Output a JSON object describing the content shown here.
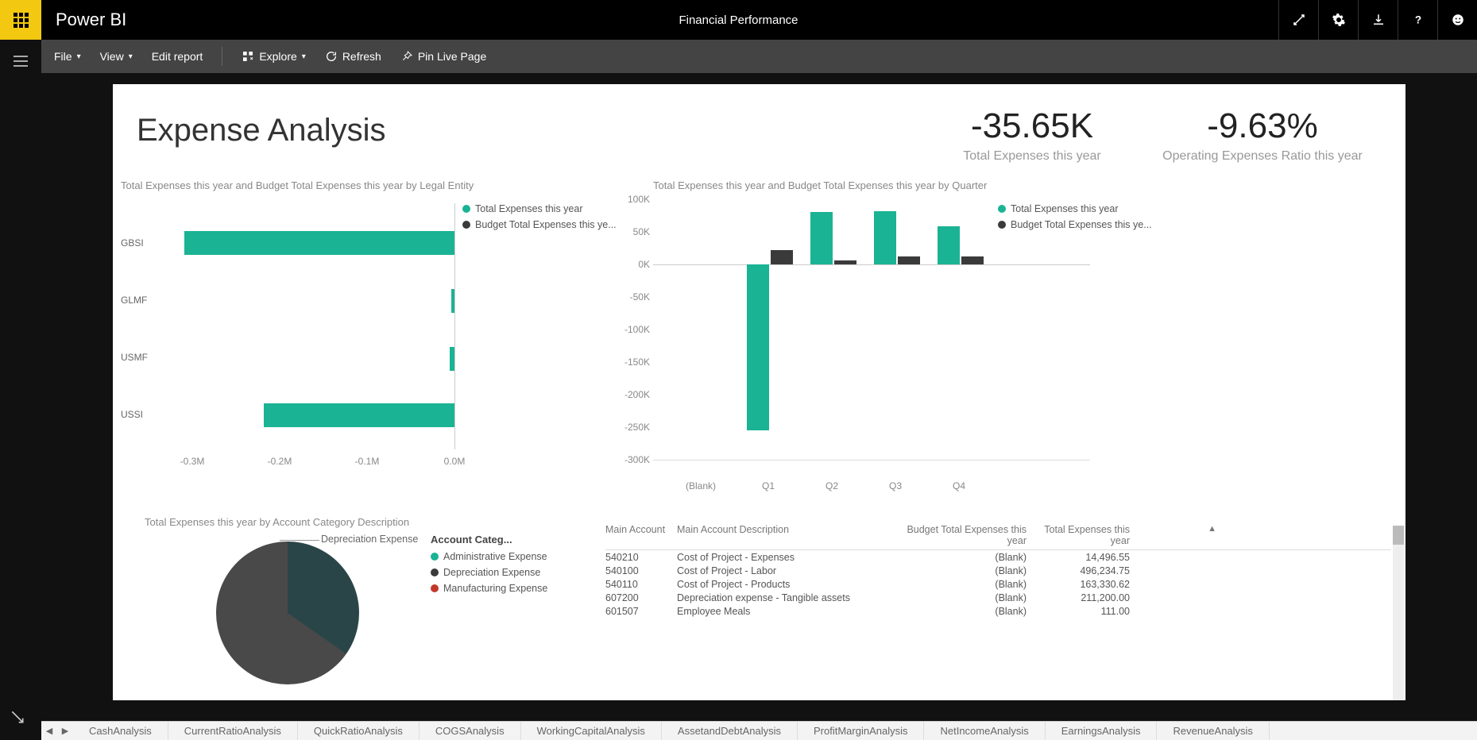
{
  "app": {
    "name": "Power BI",
    "title": "Financial Performance"
  },
  "toolbar": {
    "file": "File",
    "view": "View",
    "edit": "Edit report",
    "explore": "Explore",
    "refresh": "Refresh",
    "pin": "Pin Live Page"
  },
  "report": {
    "title": "Expense Analysis",
    "kpi1": {
      "value": "-35.65K",
      "label": "Total Expenses this year"
    },
    "kpi2": {
      "value": "-9.63%",
      "label": "Operating Expenses Ratio this year"
    },
    "chart1": {
      "title": "Total Expenses this year and Budget Total Expenses this year by Legal Entity",
      "legend1": "Total Expenses this year",
      "legend2": "Budget Total Expenses this ye...",
      "yticks": [
        "GBSI",
        "GLMF",
        "USMF",
        "USSI"
      ],
      "xticks": [
        "-0.3M",
        "-0.2M",
        "-0.1M",
        "0.0M"
      ]
    },
    "chart2": {
      "title": "Total Expenses this year and Budget Total Expenses this year by Quarter",
      "legend1": "Total Expenses this year",
      "legend2": "Budget Total Expenses this ye...",
      "yticks": [
        "100K",
        "50K",
        "0K",
        "-50K",
        "-100K",
        "-150K",
        "-200K",
        "-250K",
        "-300K"
      ],
      "xticks": [
        "(Blank)",
        "Q1",
        "Q2",
        "Q3",
        "Q4"
      ]
    },
    "chart3": {
      "title": "Total Expenses this year by Account Category Description",
      "pie_label": "Depreciation Expense"
    },
    "acct": {
      "title": "Account Categ...",
      "items": [
        "Administrative Expense",
        "Depreciation Expense",
        "Manufacturing Expense"
      ],
      "colors": [
        "#1ab394",
        "#3a3a3a",
        "#c0392b"
      ]
    },
    "table": {
      "headers": [
        "Main Account",
        "Main Account Description",
        "Budget Total Expenses this year",
        "Total Expenses this year"
      ],
      "rows": [
        [
          "540210",
          "Cost of Project  - Expenses",
          "(Blank)",
          "14,496.55"
        ],
        [
          "540100",
          "Cost of Project  - Labor",
          "(Blank)",
          "496,234.75"
        ],
        [
          "540110",
          "Cost of Project  - Products",
          "(Blank)",
          "163,330.62"
        ],
        [
          "607200",
          "Depreciation expense - Tangible assets",
          "(Blank)",
          "211,200.00"
        ],
        [
          "601507",
          "Employee Meals",
          "(Blank)",
          "111.00"
        ]
      ]
    }
  },
  "tabs": [
    "CashAnalysis",
    "CurrentRatioAnalysis",
    "QuickRatioAnalysis",
    "COGSAnalysis",
    "WorkingCapitalAnalysis",
    "AssetandDebtAnalysis",
    "ProfitMarginAnalysis",
    "NetIncomeAnalysis",
    "EarningsAnalysis",
    "RevenueAnalysis"
  ],
  "chart_data": [
    {
      "type": "bar",
      "orientation": "horizontal",
      "title": "Total Expenses this year and Budget Total Expenses this year by Legal Entity",
      "categories": [
        "GBSI",
        "GLMF",
        "USMF",
        "USSI"
      ],
      "xlabel": "",
      "ylabel": "",
      "xlim": [
        -300000,
        0
      ],
      "series": [
        {
          "name": "Total Expenses this year",
          "values": [
            -310000,
            -2000,
            -3000,
            -220000
          ]
        },
        {
          "name": "Budget Total Expenses this year",
          "values": [
            0,
            0,
            0,
            0
          ]
        }
      ]
    },
    {
      "type": "bar",
      "title": "Total Expenses this year and Budget Total Expenses this year by Quarter",
      "categories": [
        "(Blank)",
        "Q1",
        "Q2",
        "Q3",
        "Q4"
      ],
      "ylim": [
        -300000,
        100000
      ],
      "series": [
        {
          "name": "Total Expenses this year",
          "values": [
            null,
            -255000,
            80000,
            82000,
            58000
          ]
        },
        {
          "name": "Budget Total Expenses this year",
          "values": [
            null,
            22000,
            6000,
            12000,
            12000
          ]
        }
      ]
    },
    {
      "type": "pie",
      "title": "Total Expenses this year by Account Category Description",
      "series": [
        {
          "name": "Depreciation Expense",
          "value": 35
        },
        {
          "name": "Administrative Expense",
          "value": 65
        }
      ]
    }
  ]
}
